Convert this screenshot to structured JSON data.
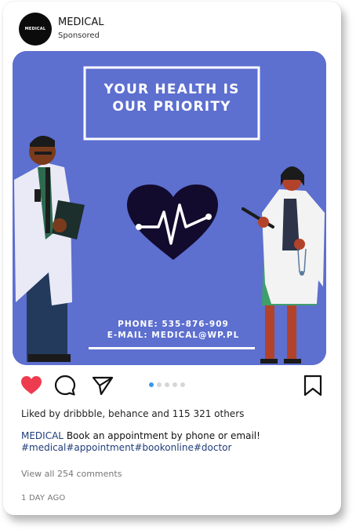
{
  "header": {
    "account_name": "MEDICAL",
    "sponsored_label": "Sponsored",
    "avatar_text": "MEDICAL"
  },
  "image": {
    "headline_line1": "YOUR HEALTH IS",
    "headline_line2": "OUR PRIORITY",
    "phone": "PHONE: 535-876-909",
    "email": "E-MAIL: MEDICAL@WP.PL"
  },
  "actions": {
    "like_icon": "heart-filled-icon",
    "comment_icon": "comment-icon",
    "share_icon": "send-icon",
    "save_icon": "bookmark-icon",
    "carousel_count": 5,
    "carousel_active": 1
  },
  "post": {
    "likes_text": "Liked by dribbble, behance and 115 321 others",
    "caption_handle": "MEDICAL",
    "caption_text": " Book an appointment by phone or email!",
    "hashtags": "#medical#appointment#bookonline#doctor",
    "view_comments": "View all 254 comments",
    "timestamp": "1 DAY AGO"
  },
  "colors": {
    "image_background": "#5d6fcf",
    "like_red": "#ef3b4f",
    "link_blue": "#1f3d7a",
    "carousel_active": "#3897f0"
  }
}
